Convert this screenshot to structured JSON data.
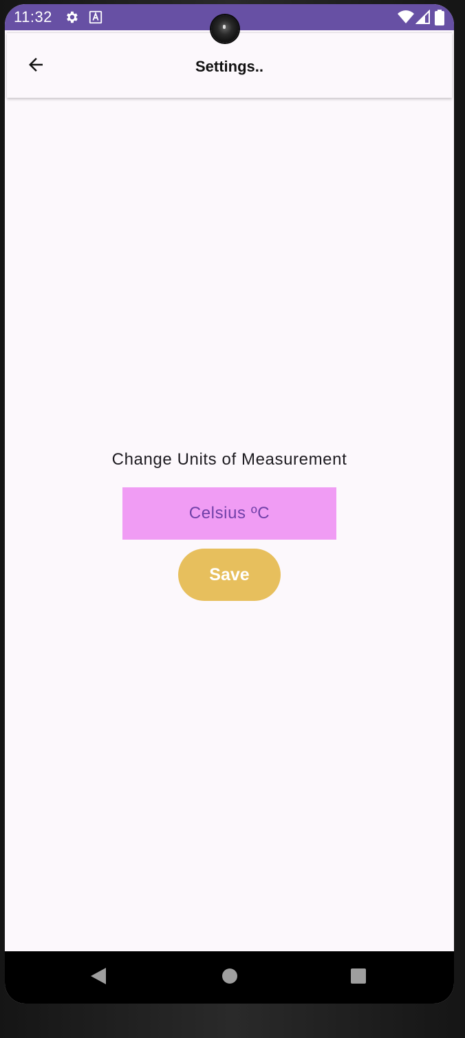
{
  "status_bar": {
    "time": "11:32",
    "icons": [
      "gear-icon",
      "a-icon",
      "wifi-icon",
      "signal-icon",
      "battery-icon"
    ],
    "background": "#6750a4"
  },
  "app_bar": {
    "title": "Settings..",
    "back_icon": "arrow-left-icon"
  },
  "main": {
    "label": "Change Units of Measurement",
    "unit_value": "Celsius ºC",
    "unit_background": "#f09cf4",
    "unit_text_color": "#7040a8",
    "save_label": "Save",
    "save_background": "#e7bf5d"
  },
  "nav_bar": {
    "buttons": [
      "back-triangle-icon",
      "home-circle-icon",
      "recents-square-icon"
    ]
  }
}
